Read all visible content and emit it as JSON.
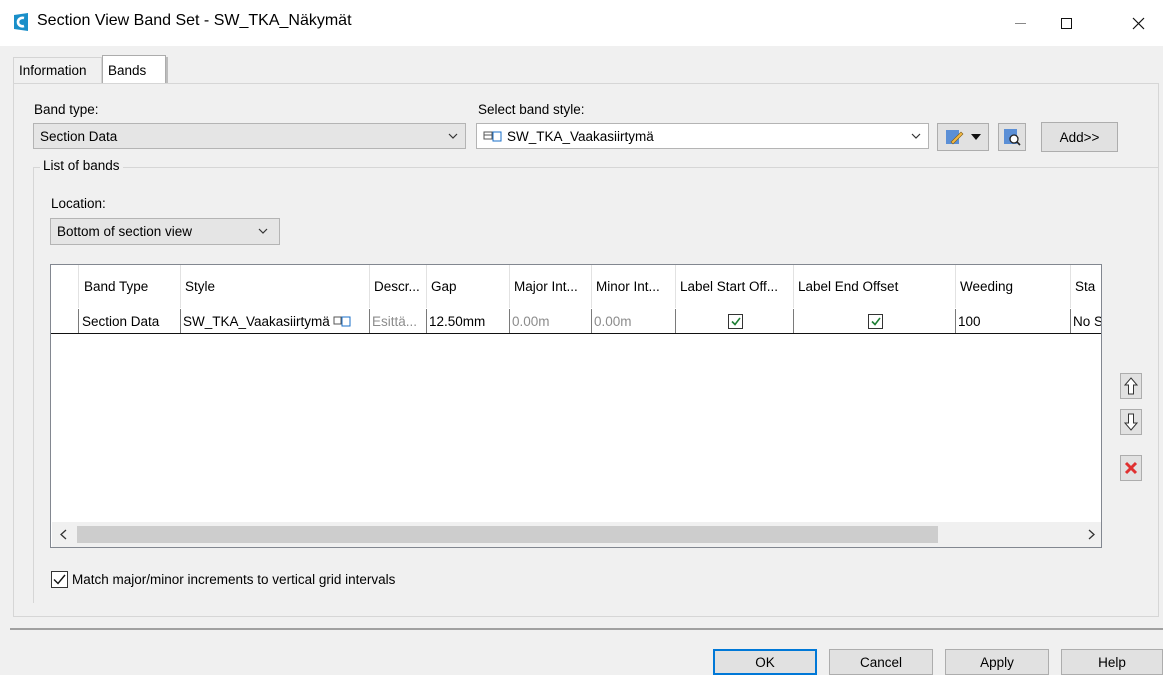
{
  "window": {
    "title": "Section View Band Set - SW_TKA_Näkymät"
  },
  "tabs": [
    {
      "label": "Information"
    },
    {
      "label": "Bands"
    }
  ],
  "band_type": {
    "label": "Band type:",
    "value": "Section Data"
  },
  "band_style": {
    "label": "Select band style:",
    "value": "SW_TKA_Vaakasiirtymä"
  },
  "add_button": "Add>>",
  "list_group": {
    "title": "List of bands"
  },
  "location": {
    "label": "Location:",
    "value": "Bottom of section view"
  },
  "grid": {
    "headers": [
      "Band Type",
      "Style",
      "Descr...",
      "Gap",
      "Major Int...",
      "Minor Int...",
      "Label Start Off...",
      "Label End Offset",
      "Weeding",
      "Sta"
    ],
    "rows": [
      {
        "band_type": "Section Data",
        "style": "SW_TKA_Vaakasiirtymä",
        "description": "Esittä...",
        "gap": "12.50mm",
        "major_interval": "0.00m",
        "minor_interval": "0.00m",
        "label_start_offset_checked": true,
        "label_end_offset_checked": true,
        "weeding": "100",
        "station": "No S"
      }
    ]
  },
  "match_checkbox": {
    "label": "Match major/minor increments to vertical grid intervals",
    "checked": true
  },
  "footer": {
    "ok": "OK",
    "cancel": "Cancel",
    "apply": "Apply",
    "help": "Help"
  },
  "icons": {
    "app": "civil3d-app-icon",
    "style": "band-style-icon",
    "edit": "edit-style-icon",
    "preview": "preview-style-icon",
    "move_up": "arrow-up-icon",
    "move_down": "arrow-down-icon",
    "delete": "delete-x-icon"
  },
  "colors": {
    "accent_blue": "#0078d7",
    "delete_red": "#e03030",
    "check_green": "#1e7e34"
  }
}
